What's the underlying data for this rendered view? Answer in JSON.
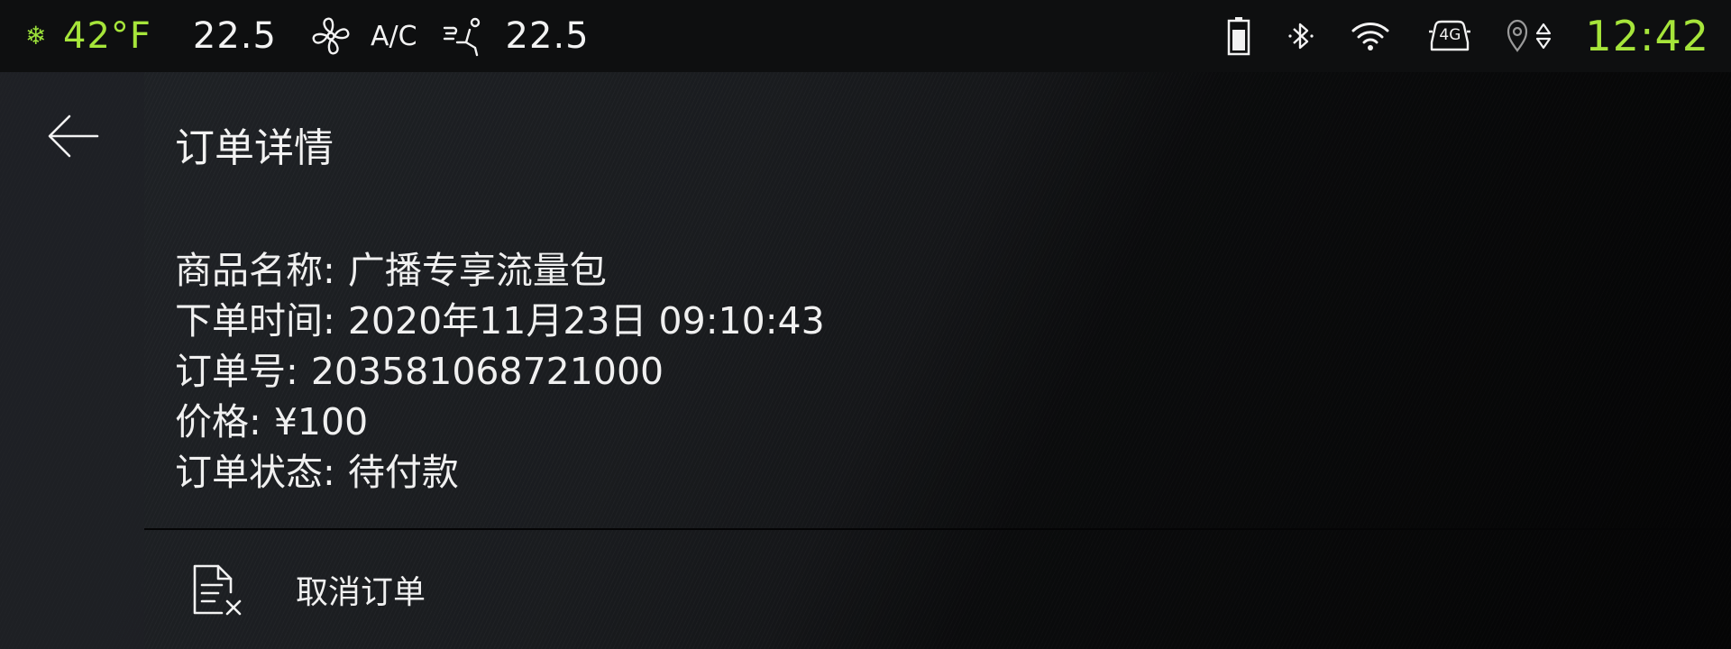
{
  "status_bar": {
    "climate_icon": "snowflake-icon",
    "outside_temp": "42°F",
    "driver_temp": "22.5",
    "fan_icon": "fan-icon",
    "ac_label": "A/C",
    "seat_icon": "seat-airflow-icon",
    "passenger_temp": "22.5",
    "battery_icon": "battery-icon",
    "bluetooth_icon": "bluetooth-icon",
    "wifi_icon": "wifi-icon",
    "network_label": "4G",
    "gps_icon": "location-icon",
    "time": "12:42"
  },
  "page": {
    "back_icon": "back-arrow-icon",
    "title": "订单详情"
  },
  "order": {
    "rows": [
      {
        "label": "商品名称:",
        "value": "广播专享流量包"
      },
      {
        "label": "下单时间:",
        "value": "2020年11月23日 09:10:43"
      },
      {
        "label": "订单号:",
        "value": "203581068721000"
      },
      {
        "label": "价格:",
        "value": "¥100"
      },
      {
        "label": "订单状态:",
        "value": "待付款"
      }
    ]
  },
  "actions": {
    "cancel_icon": "cancel-order-icon",
    "cancel_label": "取消订单"
  },
  "colors": {
    "accent_green": "#a6e53a",
    "text": "#f0f0f0",
    "background": "#1a1c1f"
  }
}
